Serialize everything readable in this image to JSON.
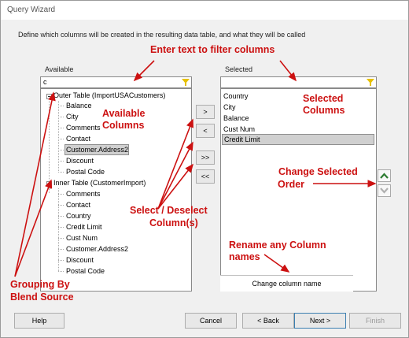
{
  "window": {
    "title": "Query Wizard"
  },
  "description": "Define which columns will be created in the resulting data table, and what they will be called",
  "available": {
    "label": "Available",
    "filter_value": "c",
    "groups": [
      {
        "name": "Outer Table (ImportUSACustomers)",
        "items": [
          "Balance",
          "City",
          "Comments",
          "Contact",
          "Customer.Address2",
          "Discount",
          "Postal Code"
        ]
      },
      {
        "name": "Inner Table (CustomerImport)",
        "items": [
          "Comments",
          "Contact",
          "Country",
          "Credit Limit",
          "Cust Num",
          "Customer.Address2",
          "Discount",
          "Postal Code"
        ]
      }
    ]
  },
  "selected": {
    "label": "Selected",
    "items": [
      "Country",
      "City",
      "Balance",
      "Cust Num",
      "Credit Limit"
    ],
    "rename_label": "Change column name"
  },
  "move_buttons": {
    "add": ">",
    "remove": "<",
    "add_all": ">>",
    "remove_all": "<<"
  },
  "footer": {
    "help": "Help",
    "cancel": "Cancel",
    "back": "< Back",
    "next": "Next >",
    "finish": "Finish"
  },
  "annotations": {
    "filter": "Enter text to filter columns",
    "available_l1": "Available",
    "available_l2": "Columns",
    "selected_l1": "Selected",
    "selected_l2": "Columns",
    "order_l1": "Change Selected",
    "order_l2": "Order",
    "select_l1": "Select / Deselect",
    "select_l2": "Column(s)",
    "rename_l1": "Rename any Column",
    "rename_l2": "names",
    "grouping_l1": "Grouping By",
    "grouping_l2": "Blend Source"
  },
  "colors": {
    "annotation": "#cc1111",
    "funnel": "#e6c000",
    "order_arrow": "#2e7d32"
  }
}
